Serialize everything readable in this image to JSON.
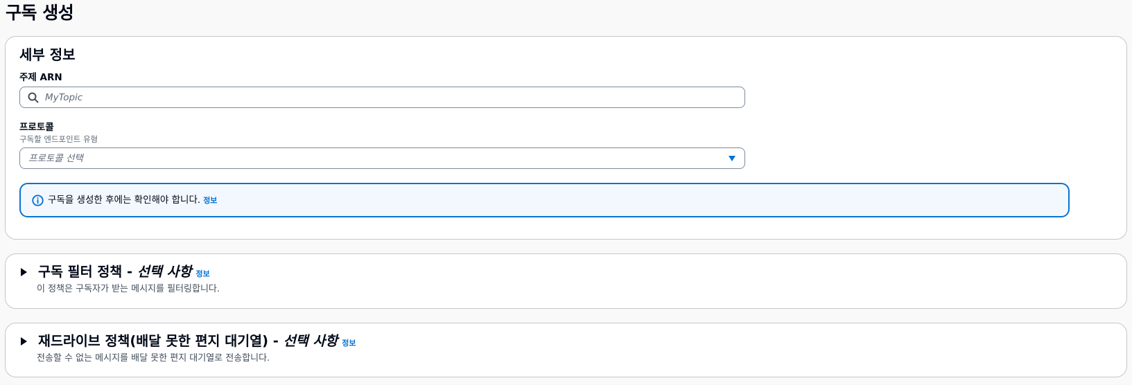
{
  "page": {
    "title": "구독 생성"
  },
  "details": {
    "title": "세부 정보",
    "topic_arn": {
      "label": "주제 ARN",
      "placeholder": "MyTopic",
      "value": ""
    },
    "protocol": {
      "label": "프로토콜",
      "description": "구독할 엔드포인트 유형",
      "placeholder": "프로토콜 선택"
    },
    "alert": {
      "text": "구독을 생성한 후에는 확인해야 합니다.",
      "link": "정보"
    }
  },
  "filter_policy": {
    "title": "구독 필터 정책 - ",
    "optional": "선택 사항",
    "info_link": "정보",
    "description": "이 정책은 구독자가 받는 메시지를 필터링합니다."
  },
  "redrive_policy": {
    "title": "재드라이브 정책(배달 못한 편지 대기열) - ",
    "optional": "선택 사항",
    "info_link": "정보",
    "description": "전송할 수 없는 메시지를 배달 못한 편지 대기열로 전송합니다."
  },
  "colors": {
    "accent": "#0972d3",
    "alert_background": "#f2f8fd",
    "border": "#c6c6cd",
    "text": "#000716"
  },
  "icons": {
    "search": "search-icon",
    "caret_down": "caret-down-icon",
    "info": "info-icon",
    "caret_right": "caret-right-icon"
  }
}
